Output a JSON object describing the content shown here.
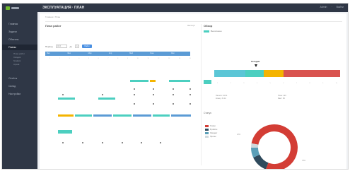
{
  "topbar": {
    "title": "ЭКСПЛУАТАЦИЯ · ПЛАН",
    "right_items": [
      "Admin",
      "·",
      "Выйти"
    ]
  },
  "sidebar": {
    "items": [
      {
        "label": "Главная",
        "active": false
      },
      {
        "label": "Задачи",
        "active": false
      },
      {
        "label": "Объекты",
        "active": false
      },
      {
        "label": "Планы",
        "active": true
      },
      {
        "label": "Отчёты",
        "active": false
      },
      {
        "label": "Склад",
        "active": false
      },
      {
        "label": "Настройки",
        "active": false
      }
    ],
    "subitems": [
      "План работ",
      "Сводка",
      "График",
      "Архив"
    ]
  },
  "breadcrumb": "Главная / План",
  "left_panel": {
    "title": "План работ",
    "link": "Экспорт",
    "filter_label_1": "Период",
    "filter_value_1": "2023",
    "filter_label_2": "до",
    "filter_value_2": "12",
    "filter_button": "Найти",
    "timeline_segments": [
      "Янв",
      "Фев",
      "Мар",
      "Апр",
      "Май",
      "Июн",
      "Июл"
    ],
    "axis_ticks": [
      "1",
      "2",
      "3",
      "4",
      "5",
      "6",
      "7",
      "8",
      "9",
      "10",
      "11",
      "12",
      "13",
      "14",
      "15"
    ]
  },
  "right_panel": {
    "title": "Обзор",
    "legend_text": "Выполнено",
    "marker_label": "Сегодня",
    "seg_axis": [
      "1",
      "2",
      "3",
      "4",
      "5",
      "6",
      "7",
      "8",
      "9",
      "10"
    ],
    "info_left": [
      "Начало: 01.01",
      "Конец: 31.12"
    ],
    "info_right": [
      "План: 120",
      "Факт: 96"
    ],
    "donut_title": "Статус",
    "donut_legend": [
      {
        "label": "Готово",
        "color": "#d33d35"
      },
      {
        "label": "В работе",
        "color": "#2f4a5c"
      },
      {
        "label": "Ожидает",
        "color": "#5a9fb8"
      },
      {
        "label": "Прочее",
        "color": "#cfd8dc"
      }
    ],
    "callout_left": "12%",
    "callout_right": "78%"
  },
  "chart_data": {
    "type": "pie",
    "categories": [
      "Готово",
      "В работе",
      "Ожидает",
      "Прочее"
    ],
    "values": [
      78,
      12,
      7,
      3
    ],
    "colors": [
      "#d33d35",
      "#2f4a5c",
      "#5a9fb8",
      "#cfd8dc"
    ],
    "donut": true
  }
}
